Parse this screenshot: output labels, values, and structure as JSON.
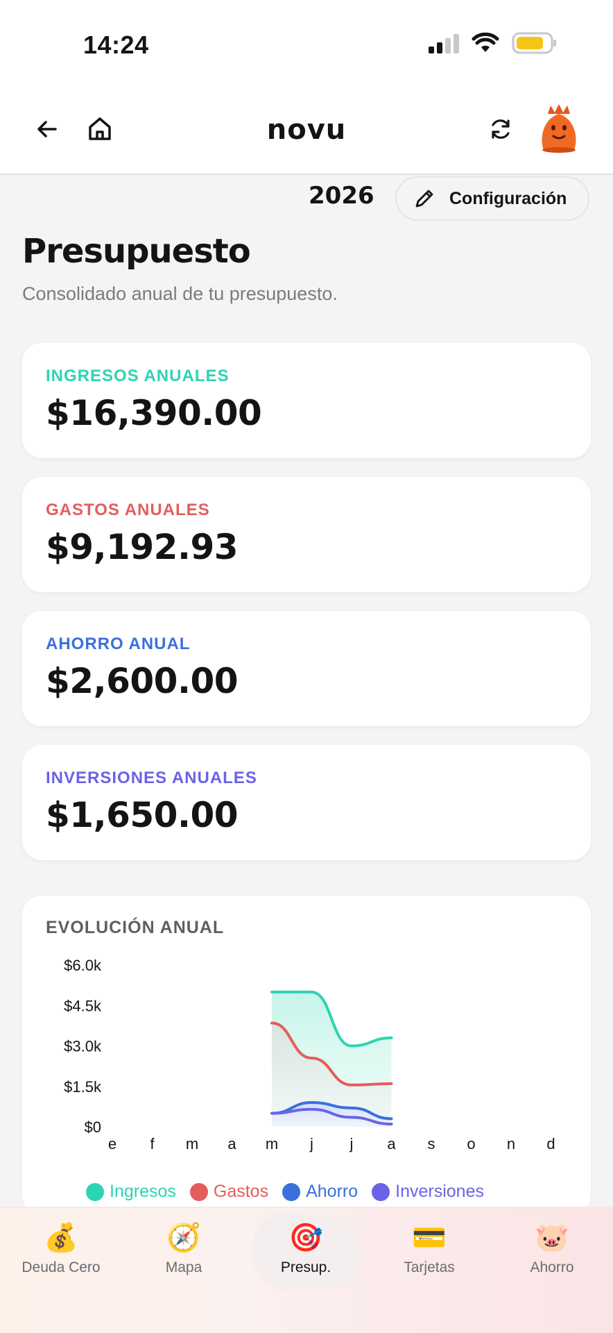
{
  "status_bar": {
    "time": "14:24"
  },
  "header": {
    "brand": "novu",
    "icons": [
      "back-arrow-icon",
      "home-icon",
      "refresh-icon",
      "avatar-monster"
    ]
  },
  "toolbar": {
    "year": "2026",
    "config_label": "Configuración"
  },
  "page": {
    "title": "Presupuesto",
    "subtitle": "Consolidado anual de tu presupuesto."
  },
  "cards": [
    {
      "label": "INGRESOS ANUALES",
      "value": "$16,390.00",
      "color": "#2dd4b3"
    },
    {
      "label": "GASTOS ANUALES",
      "value": "$9,192.93",
      "color": "#e35d5d"
    },
    {
      "label": "AHORRO ANUAL",
      "value": "$2,600.00",
      "color": "#3b6fdc"
    },
    {
      "label": "INVERSIONES ANUALES",
      "value": "$1,650.00",
      "color": "#6a63e6"
    }
  ],
  "chart": {
    "title": "EVOLUCIÓN ANUAL"
  },
  "chart_data": {
    "type": "area",
    "categories": [
      "e",
      "f",
      "m",
      "a",
      "m",
      "j",
      "j",
      "a",
      "s",
      "o",
      "n",
      "d"
    ],
    "ylim": [
      0,
      6000
    ],
    "y_ticks": [
      {
        "value": 6000,
        "label": "$6.0k"
      },
      {
        "value": 4500,
        "label": "$4.5k"
      },
      {
        "value": 3000,
        "label": "$3.0k"
      },
      {
        "value": 1500,
        "label": "$1.5k"
      },
      {
        "value": 0,
        "label": "$0"
      }
    ],
    "grid": false,
    "legend_position": "bottom",
    "series": [
      {
        "name": "Ingresos",
        "color": "#2dd4b3",
        "values": [
          null,
          null,
          null,
          null,
          5000,
          5000,
          3000,
          3300,
          null,
          null,
          null,
          null
        ]
      },
      {
        "name": "Gastos",
        "color": "#e35d5d",
        "values": [
          null,
          null,
          null,
          null,
          3850,
          2550,
          1550,
          1600,
          null,
          null,
          null,
          null
        ]
      },
      {
        "name": "Ahorro",
        "color": "#3b6fdc",
        "values": [
          null,
          null,
          null,
          null,
          500,
          900,
          700,
          300,
          null,
          null,
          null,
          null
        ]
      },
      {
        "name": "Inversiones",
        "color": "#6a63e6",
        "values": [
          null,
          null,
          null,
          null,
          500,
          650,
          350,
          100,
          null,
          null,
          null,
          null
        ]
      }
    ]
  },
  "bottom_nav": {
    "items": [
      {
        "label": "Deuda Cero",
        "icon": "💰",
        "icon_name": "money-bag-icon",
        "active": false
      },
      {
        "label": "Mapa",
        "icon": "🧭",
        "icon_name": "compass-icon",
        "active": false
      },
      {
        "label": "Presup.",
        "icon": "🎯",
        "icon_name": "target-icon",
        "active": true
      },
      {
        "label": "Tarjetas",
        "icon": "💳",
        "icon_name": "credit-card-icon",
        "active": false
      },
      {
        "label": "Ahorro",
        "icon": "🐷",
        "icon_name": "pig-icon",
        "active": false
      }
    ]
  }
}
